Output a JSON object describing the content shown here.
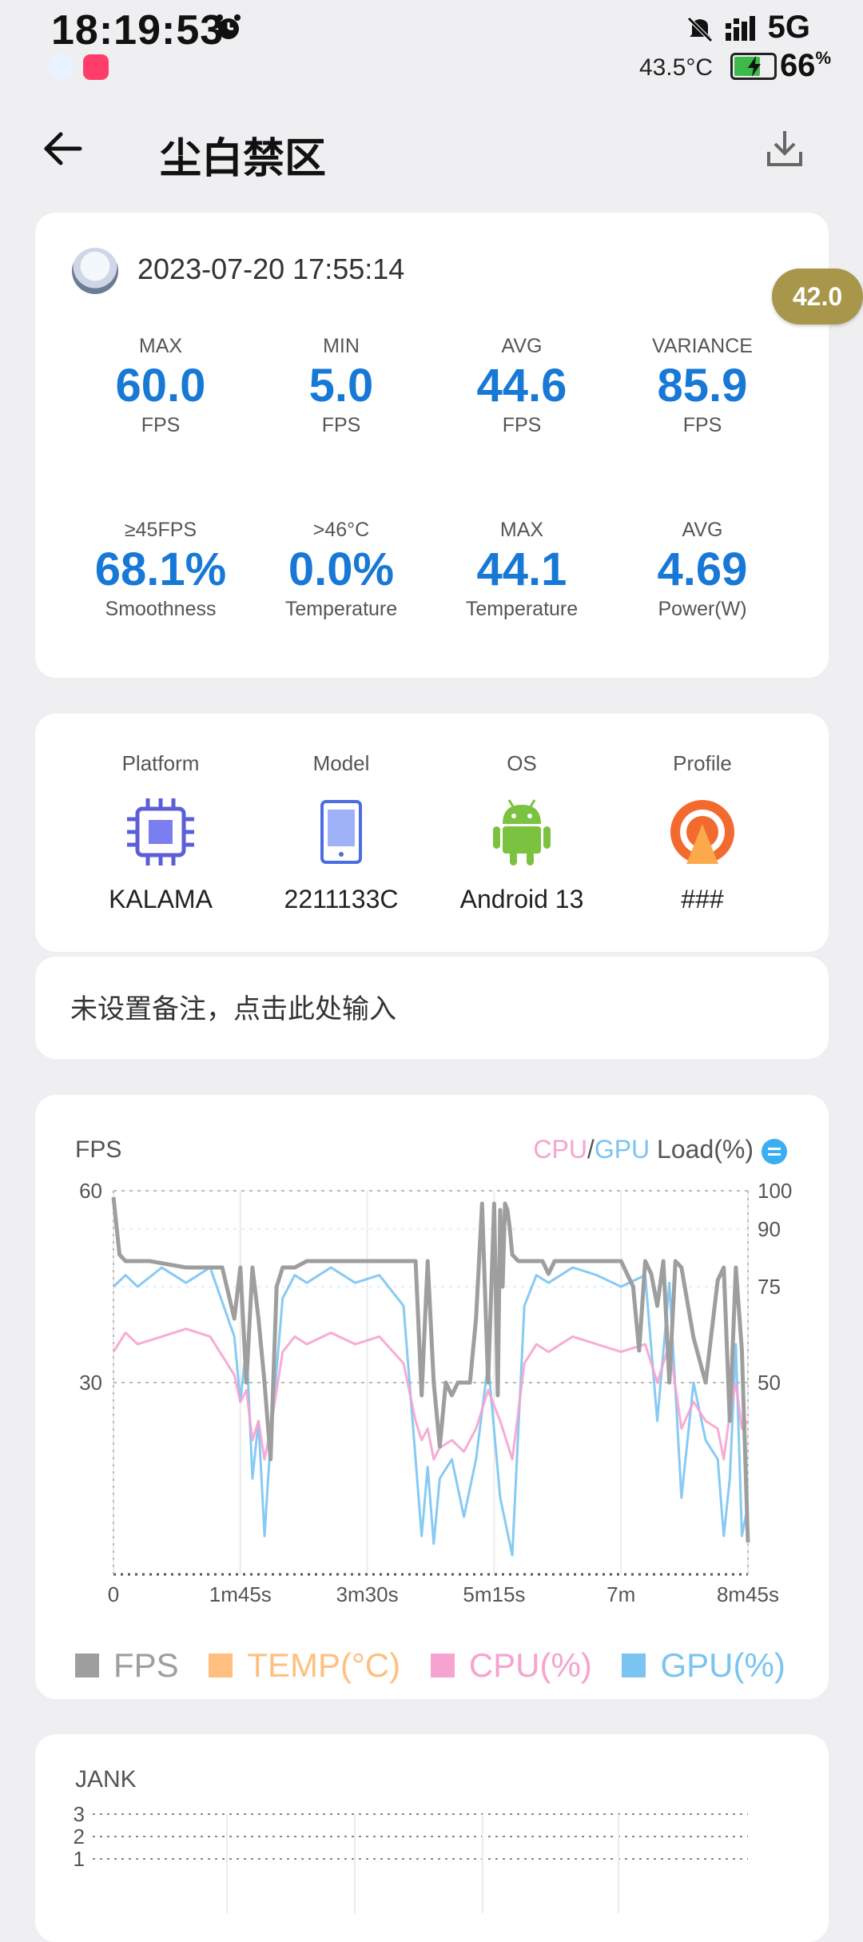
{
  "status_bar": {
    "time": "18:19:53",
    "network": "5G",
    "device_temp": "43.5°C",
    "battery": "66",
    "battery_pct_sign": "%",
    "battery_level": 0.66
  },
  "header": {
    "title": "尘白禁区"
  },
  "floating_badge": "42.0",
  "summary": {
    "datetime": "2023-07-20 17:55:14",
    "stats": [
      {
        "label": "MAX",
        "value": "60.0",
        "unit": "FPS"
      },
      {
        "label": "MIN",
        "value": "5.0",
        "unit": "FPS"
      },
      {
        "label": "AVG",
        "value": "44.6",
        "unit": "FPS"
      },
      {
        "label": "VARIANCE",
        "value": "85.9",
        "unit": "FPS"
      },
      {
        "label": "≥45FPS",
        "value": "68.1%",
        "unit": "Smoothness"
      },
      {
        "label": ">46°C",
        "value": "0.0%",
        "unit": "Temperature"
      },
      {
        "label": "MAX",
        "value": "44.1",
        "unit": "Temperature"
      },
      {
        "label": "AVG",
        "value": "4.69",
        "unit": "Power(W)"
      }
    ]
  },
  "device": {
    "items": [
      {
        "label": "Platform",
        "value": "KALAMA",
        "icon": "chip-icon"
      },
      {
        "label": "Model",
        "value": "2211133C",
        "icon": "phone-icon"
      },
      {
        "label": "OS",
        "value": "Android 13",
        "icon": "android-icon"
      },
      {
        "label": "Profile",
        "value": "###",
        "icon": "profile-icon"
      }
    ]
  },
  "note": {
    "placeholder": "未设置备注，点击此处输入"
  },
  "fps_chart": {
    "title": "FPS",
    "right_label": {
      "cpu": "CPU",
      "slash": "/",
      "gpu": "GPU",
      "rest": " Load(%)"
    },
    "legend": [
      {
        "name": "FPS",
        "color": "#9e9e9e"
      },
      {
        "name": "TEMP(°C)",
        "color": "#ffbf80"
      },
      {
        "name": "CPU(%)",
        "color": "#f6a3cf"
      },
      {
        "name": "GPU(%)",
        "color": "#7ac4f2"
      }
    ]
  },
  "jank_chart": {
    "title": "JANK"
  },
  "chart_data": [
    {
      "type": "line",
      "title": "FPS",
      "x_ticks": [
        "0",
        "1m45s",
        "3m30s",
        "5m15s",
        "7m",
        "8m45s"
      ],
      "y_left_ticks": [
        "60",
        "30"
      ],
      "y_right_ticks": [
        "100",
        "90",
        "75",
        "50"
      ],
      "ylim_left": [
        0,
        60
      ],
      "ylim_right": [
        0,
        100
      ],
      "xlim_seconds": [
        0,
        525
      ],
      "series": [
        {
          "name": "FPS",
          "color": "#9e9e9e",
          "x": [
            0,
            5,
            10,
            30,
            60,
            90,
            100,
            105,
            110,
            115,
            120,
            125,
            130,
            135,
            140,
            145,
            150,
            160,
            180,
            210,
            240,
            250,
            255,
            260,
            265,
            270,
            275,
            280,
            285,
            290,
            295,
            300,
            305,
            310,
            315,
            318,
            320,
            322,
            324,
            326,
            328,
            330,
            335,
            340,
            345,
            350,
            355,
            360,
            365,
            370,
            380,
            400,
            420,
            430,
            435,
            440,
            445,
            450,
            455,
            460,
            465,
            470,
            480,
            490,
            500,
            505,
            510,
            515,
            520,
            525
          ],
          "y": [
            59,
            50,
            49,
            49,
            48,
            48,
            40,
            48,
            30,
            48,
            40,
            30,
            18,
            45,
            48,
            48,
            48,
            49,
            49,
            49,
            49,
            49,
            28,
            49,
            30,
            20,
            30,
            28,
            30,
            30,
            30,
            40,
            58,
            30,
            58,
            28,
            57,
            45,
            58,
            57,
            54,
            50,
            49,
            49,
            49,
            49,
            49,
            47,
            49,
            49,
            49,
            49,
            49,
            45,
            35,
            49,
            47,
            42,
            49,
            30,
            49,
            48,
            37,
            30,
            46,
            48,
            24,
            48,
            35,
            5
          ]
        },
        {
          "name": "CPU(%)",
          "color": "#f6a3cf",
          "x": [
            0,
            10,
            20,
            40,
            60,
            80,
            100,
            105,
            110,
            115,
            120,
            125,
            130,
            140,
            150,
            160,
            180,
            200,
            220,
            240,
            250,
            255,
            260,
            265,
            270,
            280,
            290,
            300,
            310,
            320,
            330,
            340,
            350,
            360,
            380,
            400,
            420,
            440,
            450,
            460,
            470,
            480,
            490,
            500,
            505,
            510,
            515,
            520,
            525
          ],
          "y": [
            58,
            63,
            60,
            62,
            64,
            62,
            52,
            45,
            48,
            35,
            40,
            30,
            38,
            58,
            62,
            60,
            63,
            60,
            62,
            55,
            40,
            35,
            38,
            30,
            33,
            35,
            32,
            38,
            48,
            40,
            30,
            55,
            60,
            58,
            62,
            60,
            58,
            60,
            50,
            60,
            38,
            45,
            40,
            38,
            30,
            42,
            50,
            38,
            40
          ]
        },
        {
          "name": "GPU(%)",
          "color": "#7ac4f2",
          "x": [
            0,
            10,
            20,
            40,
            60,
            80,
            100,
            105,
            110,
            115,
            120,
            125,
            130,
            140,
            150,
            160,
            180,
            200,
            220,
            240,
            250,
            255,
            260,
            265,
            270,
            280,
            290,
            300,
            310,
            320,
            330,
            340,
            350,
            360,
            380,
            400,
            420,
            440,
            450,
            460,
            470,
            480,
            490,
            500,
            505,
            510,
            515,
            520,
            525
          ],
          "y": [
            75,
            78,
            75,
            80,
            76,
            80,
            62,
            45,
            60,
            25,
            40,
            10,
            35,
            72,
            78,
            76,
            80,
            76,
            78,
            70,
            30,
            10,
            28,
            8,
            25,
            30,
            15,
            30,
            55,
            20,
            5,
            70,
            78,
            76,
            80,
            78,
            75,
            78,
            40,
            76,
            20,
            50,
            35,
            30,
            10,
            25,
            60,
            10,
            18
          ]
        }
      ]
    },
    {
      "type": "bar",
      "title": "JANK",
      "y_ticks": [
        "3",
        "2",
        "1"
      ],
      "ylim": [
        0,
        3
      ]
    }
  ]
}
